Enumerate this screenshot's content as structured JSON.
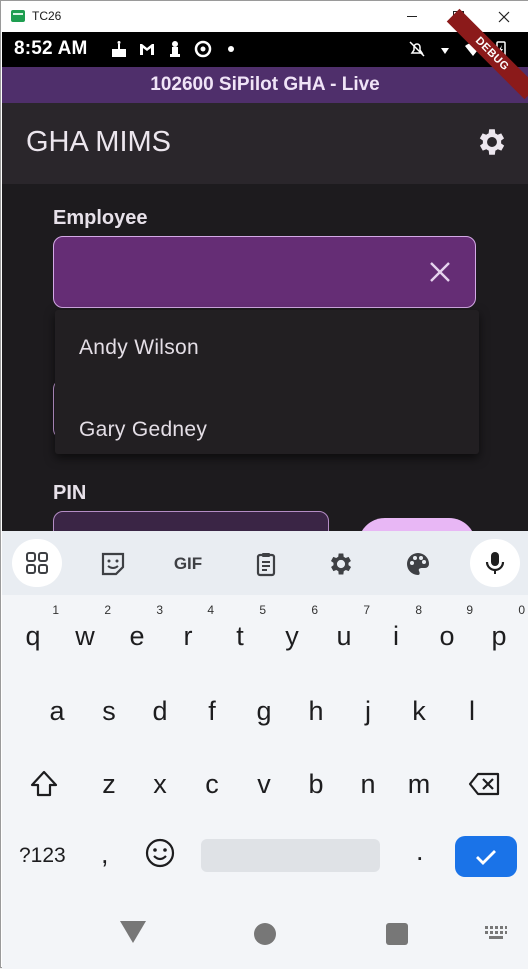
{
  "window": {
    "title": "TC26"
  },
  "status_bar": {
    "time": "8:52 AM",
    "debug_ribbon": "DEBUG"
  },
  "env_banner": "102600 SiPilot GHA - Live",
  "app_bar": {
    "title": "GHA MIMS"
  },
  "form": {
    "employee_label": "Employee",
    "employee_value": "",
    "pin_label": "PIN"
  },
  "dropdown": {
    "options": [
      "Andy Wilson",
      "Gary Gedney"
    ]
  },
  "keyboard": {
    "toolbar": {
      "gif": "GIF"
    },
    "row1": [
      {
        "k": "q",
        "n": "1"
      },
      {
        "k": "w",
        "n": "2"
      },
      {
        "k": "e",
        "n": "3"
      },
      {
        "k": "r",
        "n": "4"
      },
      {
        "k": "t",
        "n": "5"
      },
      {
        "k": "y",
        "n": "6"
      },
      {
        "k": "u",
        "n": "7"
      },
      {
        "k": "i",
        "n": "8"
      },
      {
        "k": "o",
        "n": "9"
      },
      {
        "k": "p",
        "n": "0"
      }
    ],
    "row2": [
      "a",
      "s",
      "d",
      "f",
      "g",
      "h",
      "j",
      "k",
      "l"
    ],
    "row3": [
      "z",
      "x",
      "c",
      "v",
      "b",
      "n",
      "m"
    ],
    "sym": "?123",
    "comma": ",",
    "period": "."
  },
  "colors": {
    "accent": "#1a73e8",
    "banner": "#4f2f6b",
    "field": "#652d75"
  }
}
